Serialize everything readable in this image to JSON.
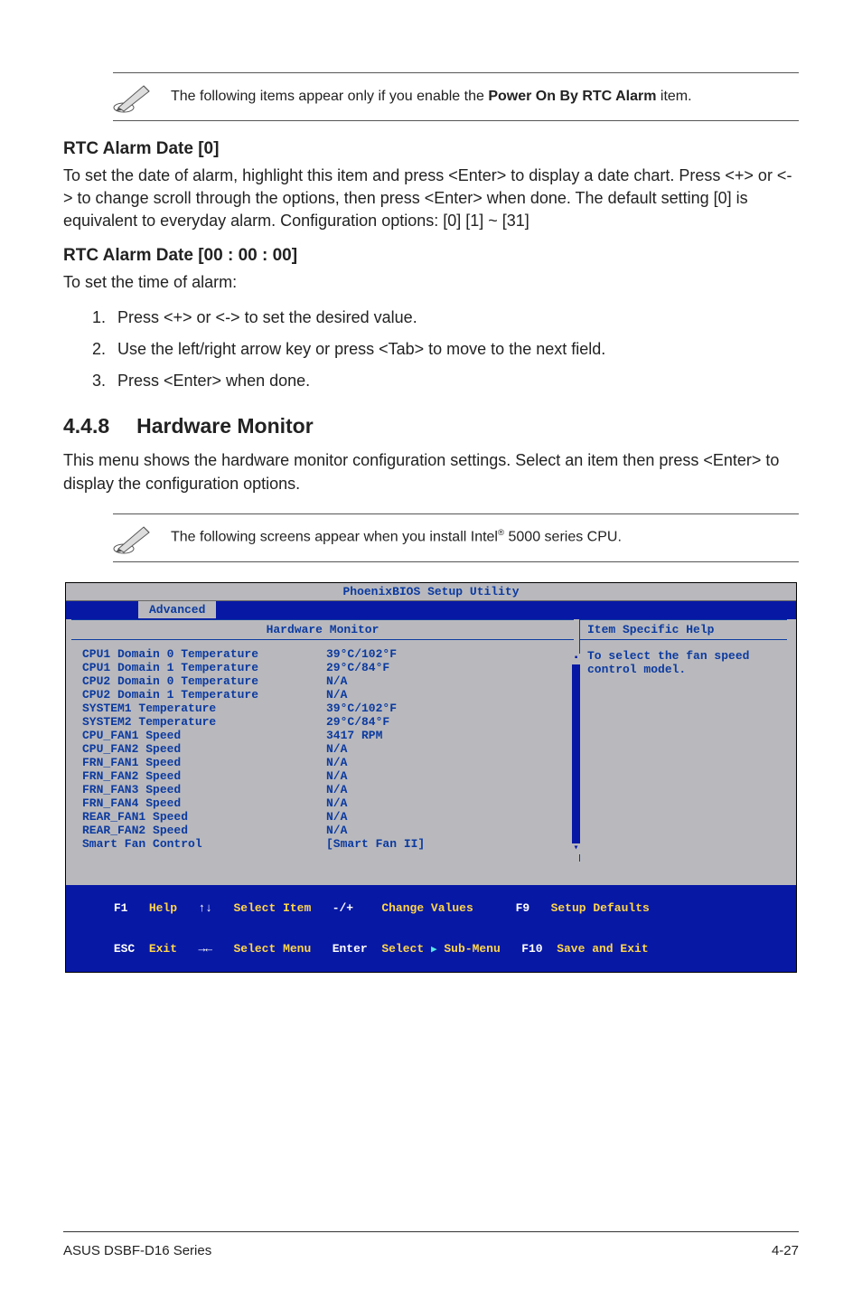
{
  "note1": {
    "prefix": "The following items appear only if you enable the ",
    "bold": "Power On By RTC Alarm",
    "suffix": " item."
  },
  "rtc_date": {
    "heading": "RTC Alarm Date [0]",
    "body": "To set the date of alarm, highlight this item and press <Enter> to display a date chart. Press <+> or <-> to change scroll through the options, then press <Enter> when done. The default setting [0] is equivalent to everyday alarm. Configuration options: [0] [1] ~ [31]"
  },
  "rtc_time": {
    "heading": "RTC Alarm Date [00 : 00 : 00]",
    "body": "To set the time of alarm:",
    "steps": [
      "Press <+> or <-> to set the desired value.",
      "Use the left/right arrow key or press <Tab> to move to the next field.",
      "Press <Enter> when done."
    ]
  },
  "section": {
    "number": "4.4.8",
    "title": "Hardware Monitor",
    "body": "This menu shows the hardware monitor configuration settings. Select an item then press <Enter> to display the configuration options."
  },
  "note2": {
    "prefix": "The following screens appear when you install Intel",
    "sup": "®",
    "suffix": " 5000 series CPU."
  },
  "bios": {
    "title": "PhoenixBIOS Setup Utility",
    "tab": "Advanced",
    "panel_title": "Hardware Monitor",
    "help_title": "Item Specific Help",
    "help_text": "To select the fan speed control model.",
    "rows": [
      {
        "label": "CPU1 Domain 0 Temperature",
        "value": "39°C/102°F"
      },
      {
        "label": "CPU1 Domain 1 Temperature",
        "value": "29°C/84°F"
      },
      {
        "label": "CPU2 Domain 0 Temperature",
        "value": "N/A"
      },
      {
        "label": "CPU2 Domain 1 Temperature",
        "value": "N/A"
      },
      {
        "label": "SYSTEM1 Temperature",
        "value": "39°C/102°F"
      },
      {
        "label": "SYSTEM2 Temperature",
        "value": "29°C/84°F"
      },
      {
        "label": "CPU_FAN1 Speed",
        "value": "3417 RPM"
      },
      {
        "label": "CPU_FAN2 Speed",
        "value": "N/A"
      },
      {
        "label": "FRN_FAN1 Speed",
        "value": "N/A"
      },
      {
        "label": "FRN_FAN2 Speed",
        "value": "N/A"
      },
      {
        "label": "FRN_FAN3 Speed",
        "value": "N/A"
      },
      {
        "label": "FRN_FAN4 Speed",
        "value": "N/A"
      },
      {
        "label": "REAR_FAN1 Speed",
        "value": "N/A"
      },
      {
        "label": "REAR_FAN2 Speed",
        "value": "N/A"
      },
      {
        "label": "Smart Fan Control",
        "value": "[Smart Fan II]"
      }
    ],
    "footer": {
      "f1": "F1",
      "help": "Help",
      "updown": "↑↓",
      "select_item": "Select Item",
      "pm": "-/+",
      "change_values": "Change Values",
      "f9": "F9",
      "setup_defaults": "Setup Defaults",
      "esc": "ESC",
      "exit": "Exit",
      "lr": "→←",
      "select_menu": "Select Menu",
      "enter": "Enter",
      "select_sub": "Select    Sub-Menu",
      "f10": "F10",
      "save_exit": "Save and Exit"
    }
  },
  "footer": {
    "left": "ASUS DSBF-D16 Series",
    "right": "4-27"
  }
}
